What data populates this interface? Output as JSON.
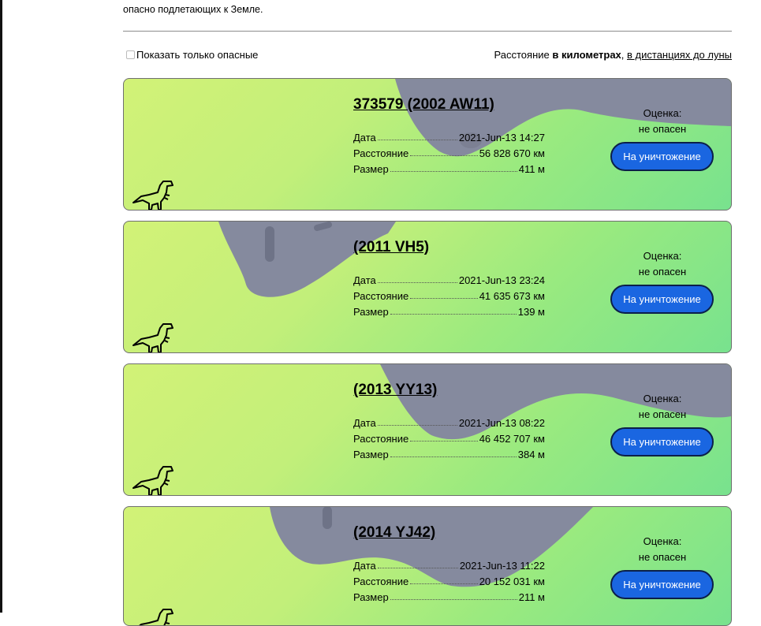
{
  "intro": {
    "line2": "опасно подлетающих к Земле."
  },
  "controls": {
    "only_dangerous_label": "Показать только опасные",
    "units_prefix": "Расстояние ",
    "units_km": "в километрах",
    "units_sep": ", ",
    "units_moon": "в дистанциях до луны"
  },
  "labels": {
    "date": "Дата",
    "distance": "Расстояние",
    "size": "Размер"
  },
  "asteroids": [
    {
      "name": "373579 (2002 AW11)",
      "date": "2021-Jun-13 14:27",
      "distance": "56 828 670 км",
      "size": "411 м",
      "assessment_label": "Оценка:",
      "assessment_value": "не опасен",
      "button": "На уничтожение"
    },
    {
      "name": "(2011 VH5)",
      "date": "2021-Jun-13 23:24",
      "distance": "41 635 673 км",
      "size": "139 м",
      "assessment_label": "Оценка:",
      "assessment_value": "не опасен",
      "button": "На уничтожение"
    },
    {
      "name": "(2013 YY13)",
      "date": "2021-Jun-13 08:22",
      "distance": "46 452 707 км",
      "size": "384 м",
      "assessment_label": "Оценка:",
      "assessment_value": "не опасен",
      "button": "На уничтожение"
    },
    {
      "name": "(2014 YJ42)",
      "date": "2021-Jun-13 11:22",
      "distance": "20 152 031 км",
      "size": "211 м",
      "assessment_label": "Оценка:",
      "assessment_value": "не опасен",
      "button": "На уничтожение"
    }
  ],
  "colors": {
    "button": "#1a66e1",
    "asteroid_shape": "#858a9e",
    "gradient_start": "#d2f277",
    "gradient_end": "#78e28e"
  }
}
